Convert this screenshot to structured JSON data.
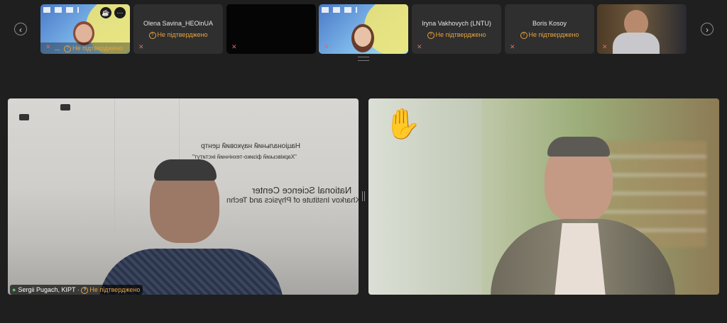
{
  "nav": {
    "prev_icon": "‹",
    "next_icon": "›"
  },
  "colors": {
    "warning": "#e8a33d",
    "background": "#1f1f1f",
    "mic_off": "#d86b6b",
    "mic_on": "#5cc06b"
  },
  "strip": {
    "tiles": [
      {
        "kind": "poster-person",
        "caption": "Не підтверджено",
        "caption_prefix": "...",
        "controls": [
          "☕",
          "⋯"
        ]
      },
      {
        "kind": "name",
        "name": "Olena Savina_HEOinUA",
        "status": "Не підтверджено"
      },
      {
        "kind": "dark"
      },
      {
        "kind": "poster-person-2"
      },
      {
        "kind": "name",
        "name": "Iryna Vakhovych (LNTU)",
        "status": "Не підтверджено"
      },
      {
        "kind": "name",
        "name": "Boris Kosoy",
        "status": "Не підтверджено"
      },
      {
        "kind": "video-person"
      }
    ]
  },
  "main": {
    "left": {
      "wall_lines": [
        "Національний науковий центр",
        "\"Харківський фізико-технічний інститут\"",
        "National Science Center",
        "\"Kharkov Institute of Physics and Techn"
      ],
      "participant": "Sergii Pugach, KIPT",
      "status": "Не підтверджено"
    },
    "right": {
      "reaction": "✋"
    }
  }
}
